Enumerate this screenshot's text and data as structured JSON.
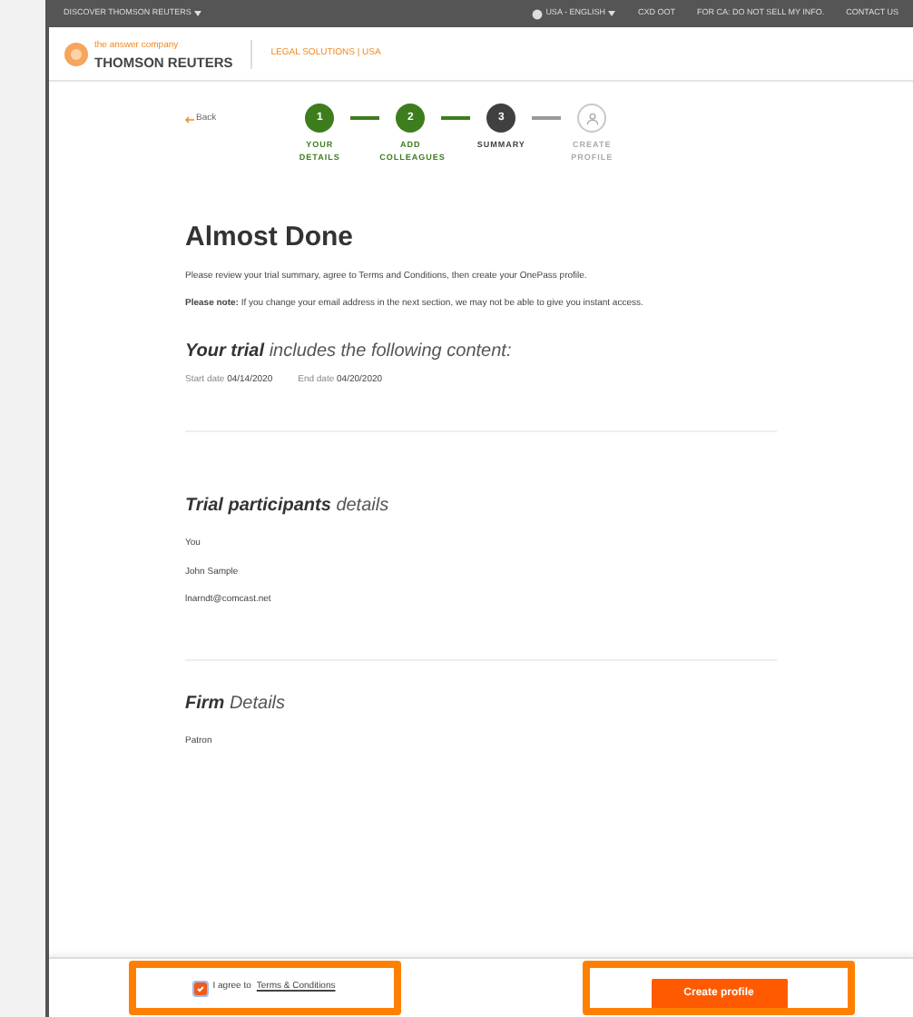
{
  "top_bar": {
    "left": "DISCOVER THOMSON REUTERS",
    "links": [
      {
        "label": "USA - ENGLISH",
        "kind": "locale"
      },
      {
        "label": "CXD OOT",
        "kind": "plain"
      },
      {
        "label": "FOR CA: DO NOT SELL MY INFO.",
        "kind": "plain"
      },
      {
        "label": "CONTACT US",
        "kind": "plain"
      }
    ]
  },
  "header": {
    "tagline": "the answer company",
    "brand": "THOMSON REUTERS",
    "section": "LEGAL SOLUTIONS | USA"
  },
  "back": "Back",
  "steps": [
    {
      "number": "1",
      "label": "YOUR DETAILS",
      "completed": true,
      "selected": false
    },
    {
      "number": "2",
      "label": "ADD COLLEAGUES",
      "completed": true,
      "selected": false
    },
    {
      "number": "3",
      "label": "SUMMARY",
      "completed": false,
      "selected": true
    },
    {
      "label": "CREATE PROFILE",
      "completed": false,
      "selected": false
    }
  ],
  "title": "Almost Done",
  "intro": "Please review your trial summary, agree to Terms and Conditions, then create your OnePass profile.",
  "note": "**Please note:** If you change your email address in the next section, we may not be able to give you instant access.",
  "trial": {
    "heading_bold": "Your trial",
    "heading_rest": "includes the following content:",
    "start_label": "Start date",
    "start_value": "04/14/2020",
    "end_label": "End date",
    "end_value": "04/20/2020"
  },
  "participants": {
    "heading_bold": "Trial participants",
    "heading_rest": "details",
    "lines": [
      "You",
      "John Sample",
      "lnarndt@comcast.net"
    ]
  },
  "firm": {
    "heading_bold": "Firm",
    "heading_rest": "Details",
    "lines": [
      "Patron"
    ]
  },
  "footer": {
    "agree_checked": true,
    "agree_text": "I agree to",
    "terms_link": "Terms & Conditions",
    "create_button": "Create profile"
  }
}
